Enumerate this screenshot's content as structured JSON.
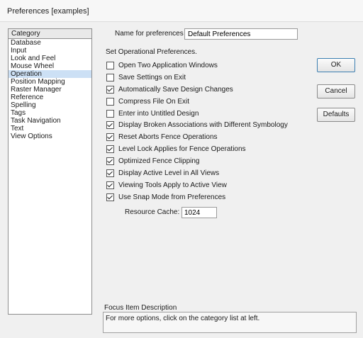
{
  "window": {
    "title": "Preferences [examples]"
  },
  "category": {
    "header": "Category",
    "items": [
      "Database",
      "Input",
      "Look and Feel",
      "Mouse Wheel",
      "Operation",
      "Position Mapping",
      "Raster Manager",
      "Reference",
      "Spelling",
      "Tags",
      "Task Navigation",
      "Text",
      "View Options"
    ],
    "selected": "Operation"
  },
  "name_field": {
    "label": "Name for preferences",
    "value": "Default Preferences"
  },
  "section_label": "Set Operational Preferences.",
  "options": [
    {
      "label": "Open Two Application Windows",
      "checked": false
    },
    {
      "label": "Save Settings on Exit",
      "checked": false
    },
    {
      "label": "Automatically Save Design Changes",
      "checked": true
    },
    {
      "label": "Compress File On Exit",
      "checked": false
    },
    {
      "label": "Enter into Untitled Design",
      "checked": false
    },
    {
      "label": "Display Broken Associations with Different Symbology",
      "checked": true
    },
    {
      "label": "Reset Aborts Fence Operations",
      "checked": true
    },
    {
      "label": "Level Lock Applies for Fence Operations",
      "checked": true
    },
    {
      "label": "Optimized Fence Clipping",
      "checked": true
    },
    {
      "label": "Display Active Level in All Views",
      "checked": true
    },
    {
      "label": "Viewing Tools Apply to Active View",
      "checked": true
    },
    {
      "label": "Use Snap Mode from Preferences",
      "checked": true
    }
  ],
  "resource_cache": {
    "label": "Resource Cache:",
    "value": "1024"
  },
  "buttons": {
    "ok": "OK",
    "cancel": "Cancel",
    "defaults": "Defaults"
  },
  "focus": {
    "label": "Focus Item Description",
    "text": "For more options, click on the category list at left."
  }
}
